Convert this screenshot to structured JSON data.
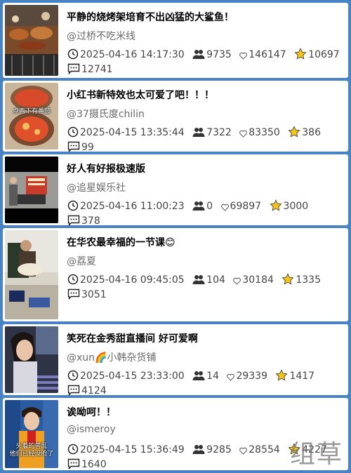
{
  "items": [
    {
      "title": "平静的烧烤架培育不出凶猛的大鲨鱼！",
      "author": "@过桥不吃米线",
      "time": "2025-04-16 14:17:30",
      "followers": "9735",
      "likes": "146147",
      "stars": "10697",
      "comments": "12741",
      "thumb_caption": ""
    },
    {
      "title": "小红书新特效也太可爱了吧！！！",
      "author": "@37摄氏度chilin",
      "time": "2025-04-15 13:35:44",
      "followers": "7322",
      "likes": "83350",
      "stars": "386",
      "comments": "99",
      "thumb_caption": "点两下有番茄"
    },
    {
      "title": "好人有好报极速版",
      "author": "@追星娱乐社",
      "time": "2025-04-16 11:00:23",
      "followers": "0",
      "likes": "69897",
      "stars": "3000",
      "comments": "378",
      "thumb_caption": ""
    },
    {
      "title": "在华农最幸福的一节课😊",
      "author": "@荔夏",
      "time": "2025-04-16 09:45:05",
      "followers": "104",
      "likes": "30184",
      "stars": "1335",
      "comments": "3051",
      "thumb_caption": ""
    },
    {
      "title": "笑死在金秀甜直播间 好可爱啊",
      "author": "@xun🌈小韩杂货铺",
      "time": "2025-04-15 23:33:00",
      "followers": "14",
      "likes": "29339",
      "stars": "1417",
      "comments": "4124",
      "thumb_caption": ""
    },
    {
      "title": "诶呦呵！！",
      "author": "@ismeroy",
      "time": "2025-04-15 15:36:49",
      "followers": "9285",
      "likes": "28554",
      "stars": "4227",
      "comments": "1640",
      "thumb_caption": "头着的兽乱\n他们已经没脸了"
    }
  ],
  "icons": {
    "time": "clock-icon",
    "followers": "users-icon",
    "likes": "heart-icon",
    "stars": "star-icon",
    "comments": "comment-icon"
  },
  "colors": {
    "background": "#4a83c4",
    "card": "#ffffff",
    "star": "#f5c518"
  },
  "watermark": "组草"
}
